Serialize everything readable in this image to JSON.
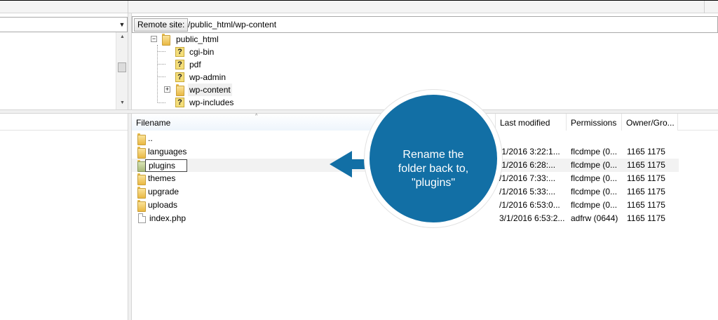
{
  "remote": {
    "label": "Remote site:",
    "path": "/public_html/wp-content"
  },
  "tree": {
    "root": "public_html",
    "items": [
      {
        "label": "cgi-bin",
        "icon": "unknown-folder-icon"
      },
      {
        "label": "pdf",
        "icon": "unknown-folder-icon"
      },
      {
        "label": "wp-admin",
        "icon": "unknown-folder-icon"
      },
      {
        "label": "wp-content",
        "icon": "folder-icon",
        "expander": "+"
      },
      {
        "label": "wp-includes",
        "icon": "unknown-folder-icon"
      }
    ],
    "root_expander": "−"
  },
  "columns": {
    "filename": "Filename",
    "last_modified": "Last modified",
    "permissions": "Permissions",
    "owner": "Owner/Gro..."
  },
  "files": [
    {
      "name": "..",
      "type": "folder",
      "modified": "",
      "perms": "",
      "owner": ""
    },
    {
      "name": "languages",
      "type": "folder",
      "modified": "/1/2016 3:22:1...",
      "perms": "flcdmpe (0...",
      "owner": "1165 1175"
    },
    {
      "name": "plugins",
      "type": "folder-green",
      "modified": "/1/2016 6:28:...",
      "perms": "flcdmpe (0...",
      "owner": "1165 1175"
    },
    {
      "name": "themes",
      "type": "folder",
      "modified": "/1/2016 7:33:...",
      "perms": "flcdmpe (0...",
      "owner": "1165 1175"
    },
    {
      "name": "upgrade",
      "type": "folder",
      "modified": "/1/2016 5:33:...",
      "perms": "flcdmpe (0...",
      "owner": "1165 1175"
    },
    {
      "name": "uploads",
      "type": "folder",
      "modified": "/1/2016 6:53:0...",
      "perms": "flcdmpe (0...",
      "owner": "1165 1175"
    },
    {
      "name": "index.php",
      "type": "file",
      "modified": "3/1/2016 6:53:2...",
      "perms": "adfrw (0644)",
      "owner": "1165 1175"
    }
  ],
  "callout": {
    "line1": "Rename the",
    "line2": "folder back to,",
    "line3": "\"plugins\"",
    "color": "#126fa5"
  },
  "icons": {
    "dropdown": "▼",
    "scroll_up": "▲",
    "scroll_down": "▼",
    "sort": "^"
  }
}
